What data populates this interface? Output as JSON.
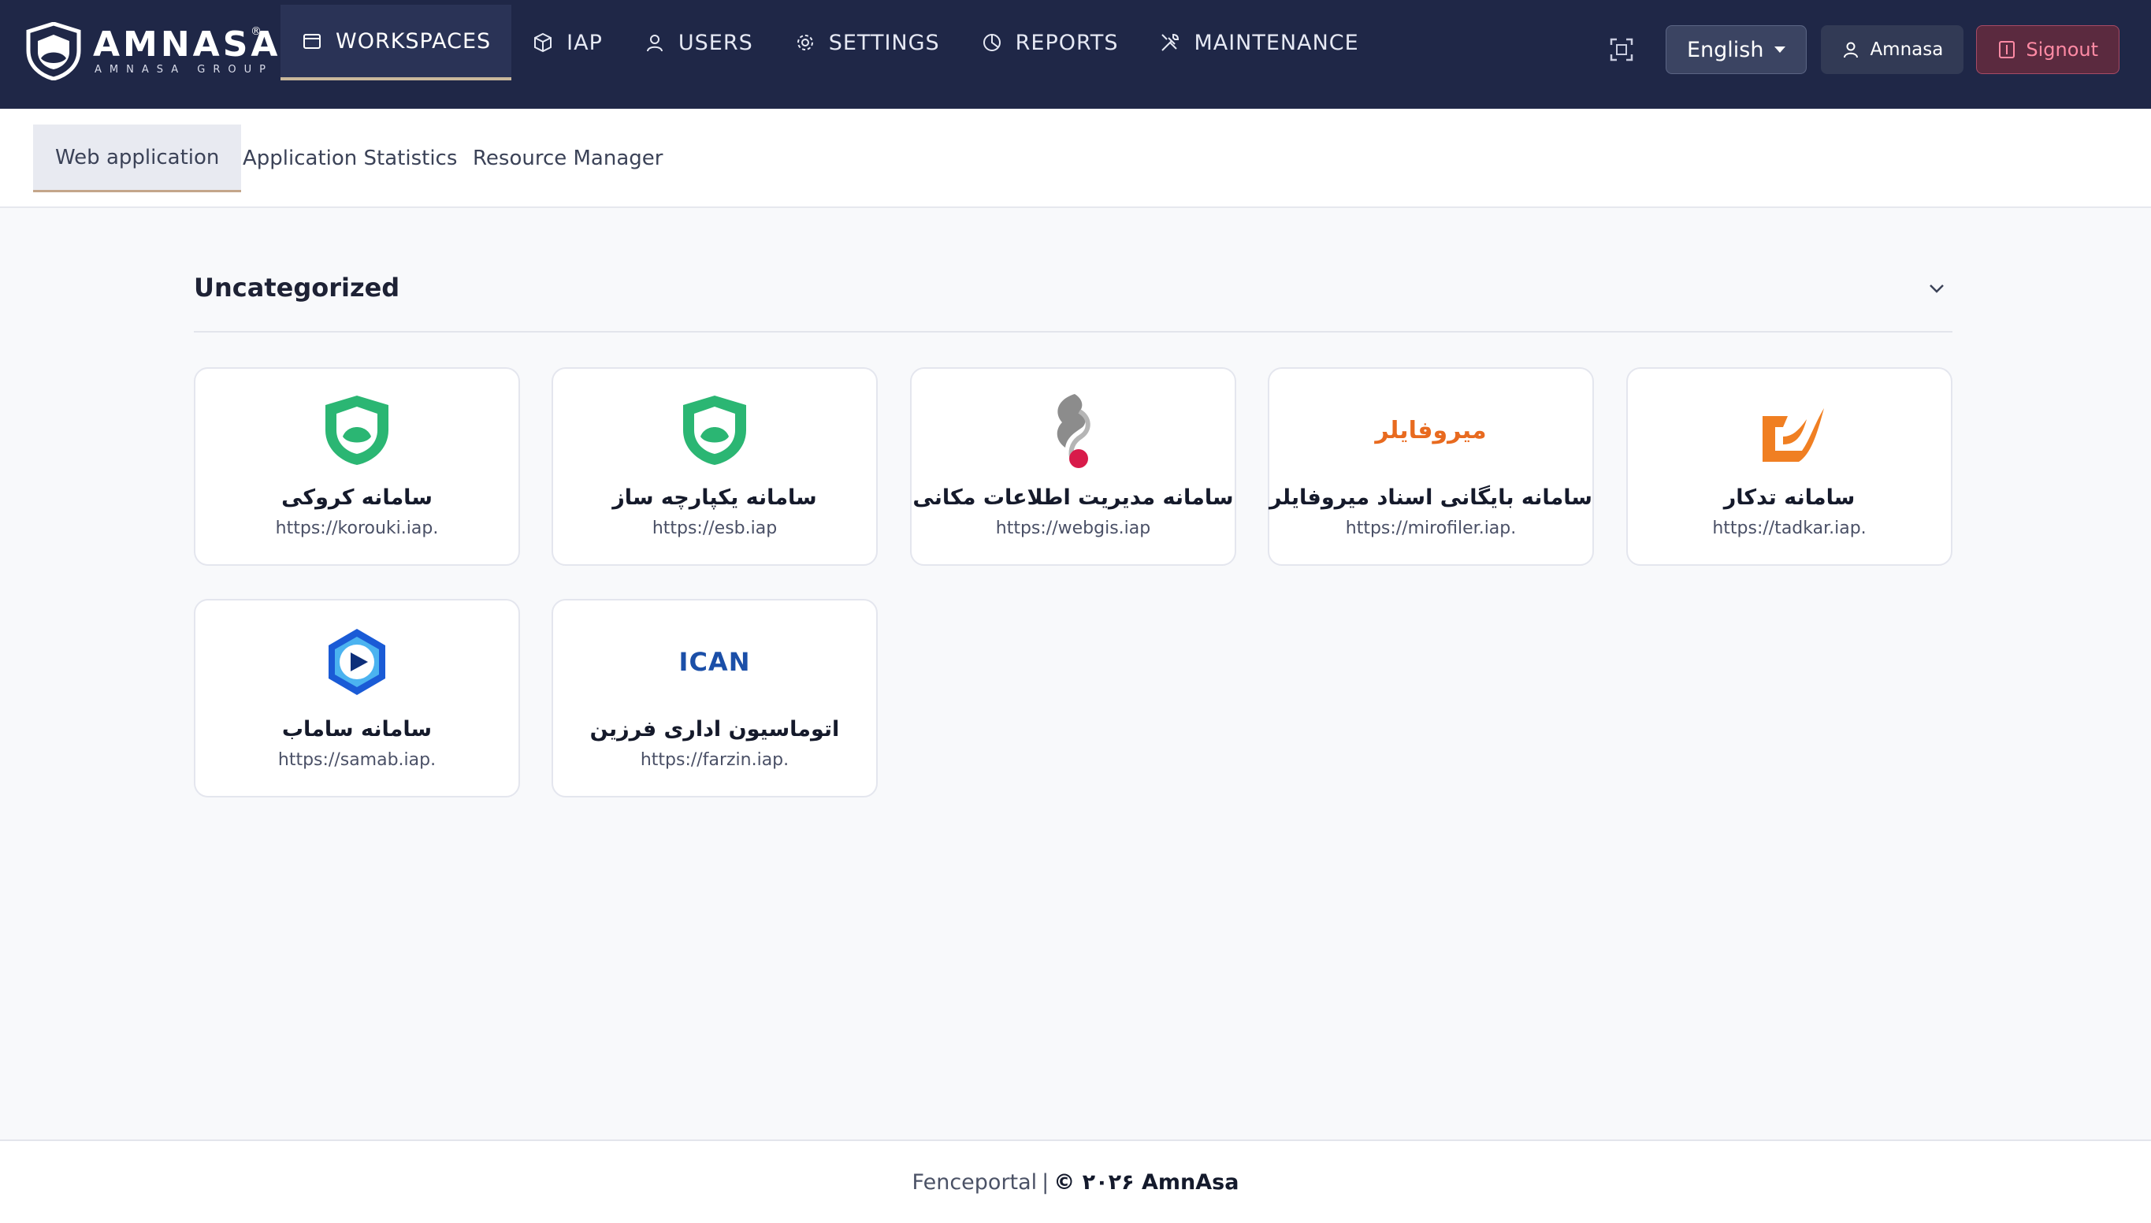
{
  "brand": {
    "name": "AMNASA",
    "subtitle": "AMNASA GROUP",
    "registered": "®"
  },
  "nav": [
    {
      "label": "WORKSPACES",
      "icon": "window-icon",
      "active": true
    },
    {
      "label": "IAP",
      "icon": "cube-icon",
      "active": false
    },
    {
      "label": "USERS",
      "icon": "user-icon",
      "active": false
    },
    {
      "label": "SETTINGS",
      "icon": "gear-icon",
      "active": false
    },
    {
      "label": "REPORTS",
      "icon": "pie-chart-icon",
      "active": false
    },
    {
      "label": "MAINTENANCE",
      "icon": "tools-icon",
      "active": false
    }
  ],
  "topbar": {
    "language": "English",
    "user": "Amnasa",
    "signout": "Signout"
  },
  "subtabs": [
    {
      "label": "Web application",
      "active": true
    },
    {
      "label": "Application Statistics",
      "active": false
    },
    {
      "label": "Resource Manager",
      "active": false
    }
  ],
  "section": {
    "title": "Uncategorized"
  },
  "apps": [
    {
      "title": "سامانه کروکی",
      "url": "https://korouki.iap.",
      "icon": "amnasa-shield-logo"
    },
    {
      "title": "سامانه یکپارچه ساز",
      "url": "https://esb.iap",
      "icon": "amnasa-shield-logo"
    },
    {
      "title": "سامانه مدیریت اطلاعات مکانی",
      "url": "https://webgis.iap",
      "icon": "webgis-logo"
    },
    {
      "title": "سامانه بایگانی اسناد میروفایلر",
      "url": "https://mirofiler.iap.",
      "icon": "mirofiler-logo",
      "logo_text": "میروفایلر"
    },
    {
      "title": "سامانه تدکار",
      "url": "https://tadkar.iap.",
      "icon": "tadkar-logo"
    },
    {
      "title": "سامانه ساماب",
      "url": "https://samab.iap.",
      "icon": "samab-logo"
    },
    {
      "title": "اتوماسیون اداری فرزین",
      "url": "https://farzin.iap.",
      "icon": "ican-logo",
      "logo_text": "ICAN"
    }
  ],
  "footer": {
    "product": "Fenceportal",
    "separator": "|",
    "copyright": "© ۲۰۲۶ AmnAsa"
  },
  "colors": {
    "topbar": "#1f2747",
    "accent_underline": "#c9b89b",
    "shield_green": "#2bb673",
    "signout": "#ff8aa4",
    "mirofiler_orange": "#e86a1f",
    "ican_blue": "#1b4fa8",
    "ican_red": "#e2231a"
  }
}
